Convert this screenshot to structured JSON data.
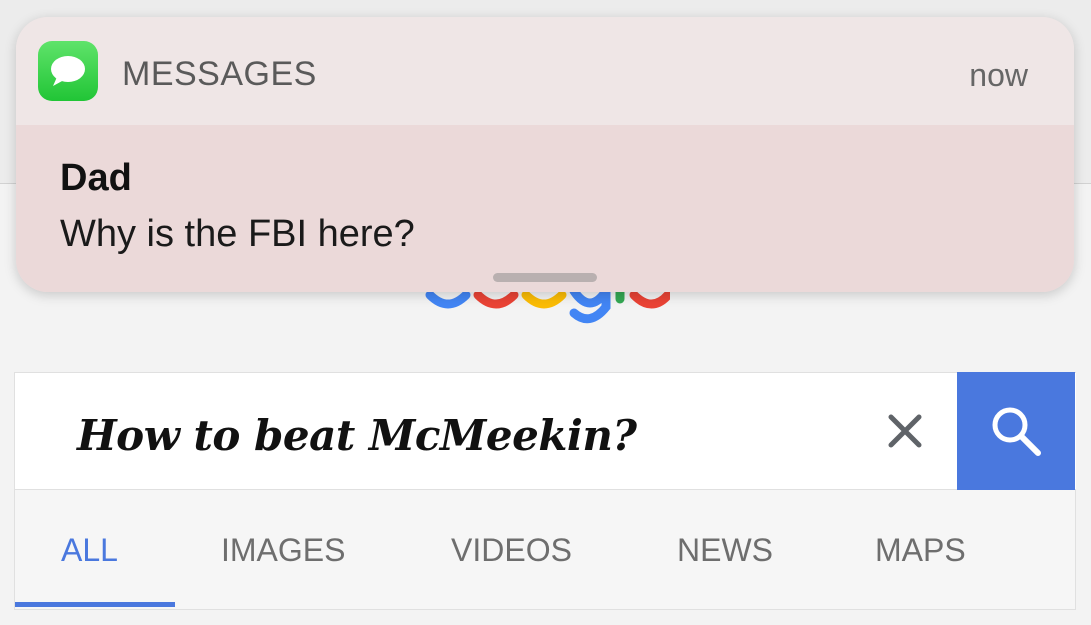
{
  "notification": {
    "app_name": "MESSAGES",
    "time": "now",
    "sender": "Dad",
    "message": "Why is the FBI here?"
  },
  "search": {
    "query": "How to beat McMeekin?"
  },
  "tabs": [
    {
      "label": "ALL",
      "active": true
    },
    {
      "label": "IMAGES",
      "active": false
    },
    {
      "label": "VIDEOS",
      "active": false
    },
    {
      "label": "NEWS",
      "active": false
    },
    {
      "label": "MAPS",
      "active": false
    }
  ],
  "colors": {
    "accent_blue": "#4a78de",
    "messages_green": "#21c536"
  },
  "icons": [
    "messages-icon",
    "clear-icon",
    "search-icon",
    "google-logo"
  ]
}
